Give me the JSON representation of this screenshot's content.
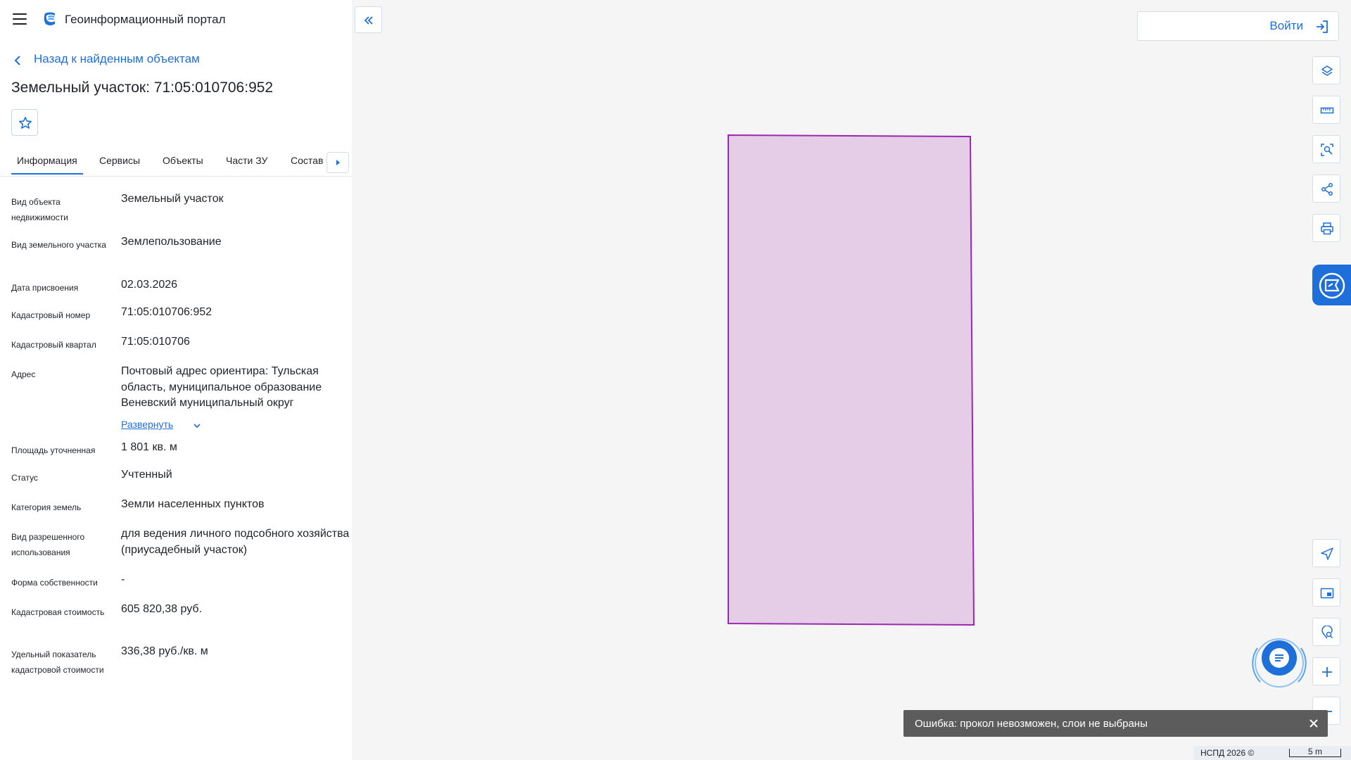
{
  "header": {
    "title": "Геоинформационный портал"
  },
  "back_link": "Назад к найденным объектам",
  "object_title": "Земельный участок: 71:05:010706:952",
  "tabs": [
    {
      "label": "Информация",
      "active": true
    },
    {
      "label": "Сервисы"
    },
    {
      "label": "Объекты"
    },
    {
      "label": "Части ЗУ"
    },
    {
      "label": "Состав"
    }
  ],
  "info": [
    {
      "label": "Вид объекта недвижимости",
      "value": "Земельный участок"
    },
    {
      "label": "Вид земельного участка",
      "value": "Землепользование"
    },
    {
      "label": "Дата присвоения",
      "value": "02.03.2026"
    },
    {
      "label": "Кадастровый номер",
      "value": "71:05:010706:952"
    },
    {
      "label": "Кадастровый квартал",
      "value": "71:05:010706"
    },
    {
      "label": "Адрес",
      "value": "Почтовый адрес ориентира: Тульская область, муниципальное образование Веневский муниципальный округ",
      "expand_label": "Развернуть"
    },
    {
      "label": "Площадь уточненная",
      "value": "1 801 кв. м"
    },
    {
      "label": "Статус",
      "value": "Учтенный"
    },
    {
      "label": "Категория земель",
      "value": "Земли населенных пунктов"
    },
    {
      "label": "Вид разрешенного использования",
      "value": "для ведения личного подсобного хозяйства (приусадебный участок)"
    },
    {
      "label": "Форма собственности",
      "value": "-"
    },
    {
      "label": "Кадастровая стоимость",
      "value": "605 820,38 руб."
    },
    {
      "label": "Удельный показатель кадастровой стоимости",
      "value": "336,38 руб./кв. м"
    }
  ],
  "map": {
    "login_label": "Войти",
    "toolbar_top": [
      "layers-icon",
      "ruler-icon",
      "area-select-icon",
      "share-icon",
      "print-icon"
    ],
    "toolbar_bottom": [
      "locate-icon",
      "minimap-icon",
      "geo-search-icon",
      "zoom-in-icon",
      "zoom-out-icon"
    ],
    "parcel_fill": "#e5cde8",
    "parcel_stroke": "#9c27b0",
    "accent": "#1e6fd9",
    "toast": "Ошибка: прокол невозможен, слои не выбраны",
    "attribution": "НСПД 2026 ©",
    "scale_label": "5 m"
  }
}
